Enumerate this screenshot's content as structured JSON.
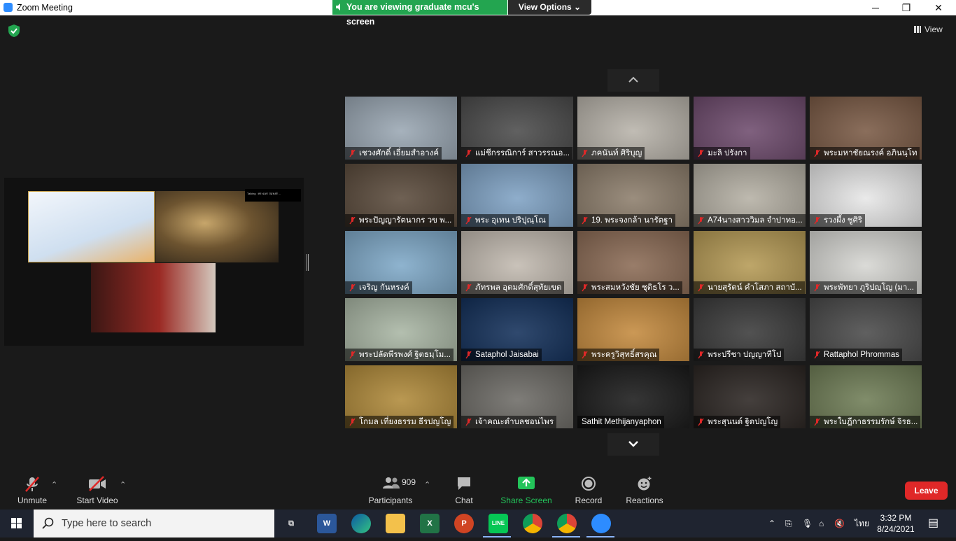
{
  "window": {
    "title": "Zoom Meeting",
    "minimize": "─",
    "restore": "❐",
    "close": "✕"
  },
  "share_banner": {
    "text": "You are viewing graduate mcu's screen",
    "view_options": "View Options ⌄"
  },
  "view_button": "View",
  "shared_screen": {
    "label": "Talking : พระมหา สมพงษ์ ..."
  },
  "participants": [
    {
      "name": "เชวงศักดิ์ เอี่ยมสำอางค์",
      "muted": true,
      "bg": "#9aa7b3"
    },
    {
      "name": "แม่ชีกรรณิการ์ สาวรรณอ...",
      "muted": true,
      "bg": "#4b4b4b"
    },
    {
      "name": "ภคนันท์ ศิริบุญ",
      "muted": true,
      "bg": "#b8b3aa"
    },
    {
      "name": "มะลิ ปรังกา",
      "muted": true,
      "bg": "#6e4b6d"
    },
    {
      "name": "พระมหาชัยณรงค์ อภินนฺโท",
      "muted": true,
      "bg": "#7a5a45"
    },
    {
      "name": "พระปัญญารัตนากร วข พ...",
      "muted": true,
      "bg": "#5b4b3c"
    },
    {
      "name": "พระ อุเทน ปริปุณฺโณ",
      "muted": true,
      "bg": "#7fa2c4"
    },
    {
      "name": "19. พระจงกล้า นารัตฐา",
      "muted": true,
      "bg": "#8d7e6c"
    },
    {
      "name": "A74นางสาววิมล จำปาทอ...",
      "muted": true,
      "bg": "#b5b0a4"
    },
    {
      "name": "รวงผึ้ง ชูศิริ",
      "muted": true,
      "bg": "#e7e7e7"
    },
    {
      "name": "เจริญ  กันหรงค์",
      "muted": true,
      "bg": "#7fa9c8"
    },
    {
      "name": "ภัทรพล อุดมศักดิ์สุทัยเขต",
      "muted": true,
      "bg": "#c2bab0"
    },
    {
      "name": "พระสมหวังชัย ชุติธโร ว...",
      "muted": true,
      "bg": "#8b6b55"
    },
    {
      "name": "นายสุรัตน์ คำโสภา สถาบั...",
      "muted": true,
      "bg": "#b59a55"
    },
    {
      "name": "พระพัทยา ภูริปญฺโญ (มา...",
      "muted": true,
      "bg": "#d6d6d2"
    },
    {
      "name": "พระปลัดพีรพงศ์ ฐิตธมฺโม...",
      "muted": true,
      "bg": "#a9b6a4"
    },
    {
      "name": "Sataphol Jaisabai",
      "muted": true,
      "bg": "#13305a"
    },
    {
      "name": "พระครูวิสุทธิ์สรคุณ",
      "muted": true,
      "bg": "#c48a3e"
    },
    {
      "name": "พระปรีชา ปญญาทีโป",
      "muted": true,
      "bg": "#3a3a3a"
    },
    {
      "name": "Rattaphol Phrommas",
      "muted": true,
      "bg": "#4a4a4a"
    },
    {
      "name": "โกมล เที่ยงธรรม ธีรปญโญ",
      "muted": true,
      "bg": "#b08a3a"
    },
    {
      "name": "เจ้าคณะตำบลชอนไพร",
      "muted": true,
      "bg": "#6d6b66"
    },
    {
      "name": "Sathit Methijanyaphon",
      "muted": false,
      "bg": "#1a1a1a"
    },
    {
      "name": "พระสุนนต์ ฐิตปญโญ",
      "muted": true,
      "bg": "#2b2522"
    },
    {
      "name": "พระใบฎีกาธรรมรักษ์ จิรธ...",
      "muted": true,
      "bg": "#6f7d56"
    }
  ],
  "controls": {
    "unmute": "Unmute",
    "start_video": "Start Video",
    "participants_count": "909",
    "participants": "Participants",
    "chat": "Chat",
    "share_screen": "Share Screen",
    "record": "Record",
    "reactions": "Reactions",
    "leave": "Leave"
  },
  "taskbar": {
    "search_placeholder": "Type here to search",
    "language": "ไทย",
    "time": "3:32 PM",
    "date": "8/24/2021",
    "apps": [
      "task-view",
      "word",
      "edge",
      "file-explorer",
      "excel",
      "powerpoint",
      "line",
      "chrome",
      "chrome-2",
      "zoom"
    ]
  },
  "colors": {
    "banner_green": "#23a550",
    "leave_red": "#e02828",
    "zoom_blue": "#2d8cff",
    "mute_red": "#e02828"
  }
}
